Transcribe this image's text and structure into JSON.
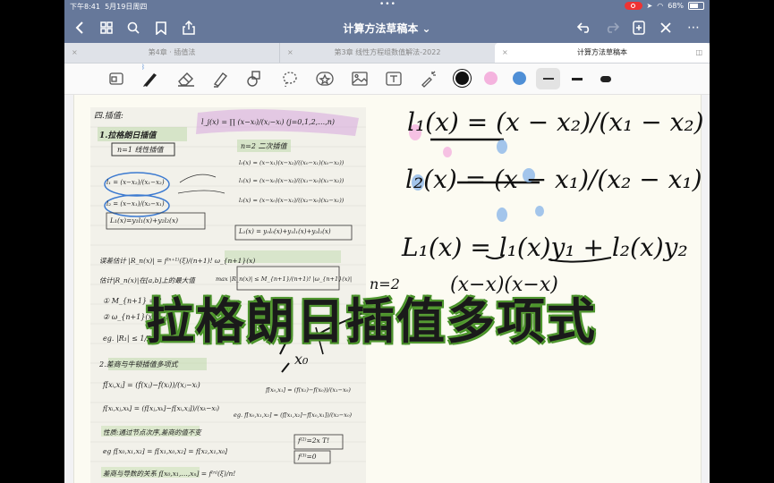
{
  "status_bar": {
    "time": "下午8:41",
    "date": "5月19日周四",
    "battery": "68%"
  },
  "nav": {
    "title": "计算方法草稿本 ⌄"
  },
  "tabs": [
    {
      "label": "第4章 · 插值法"
    },
    {
      "label": "第3章 线性方程组数值解法-2022"
    },
    {
      "label": "计算方法草稿本"
    }
  ],
  "colors": {
    "black": "#111111",
    "pink": "#f4b3de",
    "blue": "#4f8fd6",
    "status_bar": "#66789a"
  },
  "notes": {
    "left": [
      "四.插值:",
      "1.拉格朗日插值",
      "n=1 线性插值",
      "l₁ = (x−x₂)/(x₁−x₂)",
      "l₂ = (x−x₁)/(x₂−x₁)",
      "L₁(x)=y₁l₁(x)+y₂l₂(x)",
      "误差估计 |R_n(x)| = f⁽ⁿ⁺¹⁾(ξ)/(n+1)! ω_{n+1}(x)",
      "估计|R_n(x)|在[a,b]上的最大值",
      "① M_{n+1} = ?",
      "② ω_{n+1}(x) = ?",
      "eg. |R₁| ≤ 1/2!",
      "2.差商与牛顿插值多项式",
      "f[xᵢ,xⱼ] = (f(xⱼ)−f(xᵢ))/(xⱼ−xᵢ)",
      "f[xᵢ,xⱼ,xₖ] = (f[xⱼ,xₖ]−f[xᵢ,xⱼ])/(xₖ−xᵢ)",
      "性质:通过节点次序,差商的值不变",
      "eg f[x₀,x₁,x₂] = f[x₁,x₀,x₂] = f[x₂,x₁,x₀]",
      "差商与导数的关系 f[x₀,x₁,…,xₙ] = f⁽ⁿ⁾(ξ)/n!"
    ],
    "middle": [
      "l_j(x) = ∏ (x−xᵢ)/(xⱼ−xᵢ)  (j=0,1,2,…,n)",
      "n=2 二次插值",
      "l₀(x) = (x−x₁)(x−x₂)/((x₀−x₁)(x₀−x₂))",
      "l₁(x) = (x−x₀)(x−x₂)/((x₁−x₀)(x₁−x₂))",
      "l₂(x) = (x−x₀)(x−x₁)/((x₂−x₀)(x₂−x₁))",
      "L₂(x) = y₀l₀(x)+y₁l₁(x)+y₂l₂(x)",
      "max |R_n(x)| ≤ M_{n+1}/(n+1)! |ω_{n+1}(x)|",
      "f[x₀,x₁] = (f(x₁)−f(x₀))/(x₁−x₀)",
      "eg. f[x₀,x₁,x₂] = (f[x₁,x₂]−f[x₀,x₁])/(x₂−x₀)",
      "f⁽²⁾=2x T!",
      "f⁽³⁾=0"
    ],
    "right": [
      "l₁(x) = (x − x₂)/(x₁ − x₂)",
      "l₂(x) = (x − x₁)/(x₂ − x₁)",
      "L₁(x) = l₁(x)y₁ + l₂(x)y₂",
      "n=2",
      "(x−x)(x−x)",
      "x₀"
    ]
  },
  "caption": "拉格朗日插值多项式"
}
